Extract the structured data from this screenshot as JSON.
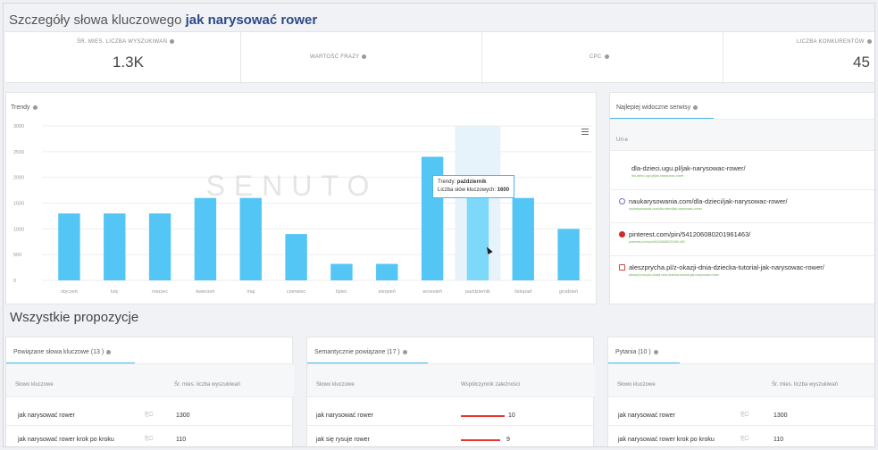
{
  "header": {
    "title_prefix": "Szczegóły słowa kluczowego",
    "keyword": "jak narysować rower"
  },
  "stats": [
    {
      "label": "ŚR. MIES. LICZBA WYSZUKIWAŃ",
      "value": "1.3K"
    },
    {
      "label": "WARTOŚĆ FRAZY",
      "value": ""
    },
    {
      "label": "CPC",
      "value": ""
    },
    {
      "label": "LICZBA KONKURENTÓW",
      "value": "45"
    }
  ],
  "trends": {
    "title": "Trendy",
    "watermark": "SENUTO",
    "tooltip": {
      "series": "Trendy:",
      "month": "październik",
      "label": "Liczba słów kluczowych:",
      "value": "1600"
    }
  },
  "chart_data": {
    "type": "bar",
    "categories": [
      "styczeń",
      "luty",
      "marzec",
      "kwiecień",
      "maj",
      "czerwiec",
      "lipiec",
      "sierpień",
      "wrzesień",
      "październik",
      "listopad",
      "grudzień"
    ],
    "values": [
      1300,
      1300,
      1300,
      1600,
      1600,
      900,
      320,
      320,
      2400,
      1600,
      1600,
      1000
    ],
    "yticks": [
      "3000",
      "2500",
      "2000",
      "1500",
      "1000",
      "500",
      "0"
    ],
    "ylim": [
      0,
      3000
    ],
    "highlight_index": 9,
    "bar_color": "#54c6f5",
    "highlight_color": "#7dd8fa"
  },
  "services": {
    "title": "Najlepiej widoczne serwisy",
    "col": "Url-e",
    "rows": [
      {
        "icon": "",
        "url": "dla-dzieci.ugu.pl/jak-narysowac-rower/",
        "sub": "dla-dzieci.ugu.pl/jak-narysowac-rower"
      },
      {
        "icon": "globe-icon",
        "url": "naukarysowania.com/dla-dzieci/jak-narysowac-rower/",
        "sub": "naukarysowania.com/dla-dzieci/jak-narysowac-rower"
      },
      {
        "icon": "pinterest-icon",
        "url": "pinterest.com/pin/541206080201961463/",
        "sub": "pinterest.com/pin/541206080201961463"
      },
      {
        "icon": "blog-icon",
        "url": "aleszprycha.pl/z-okazji-dnia-dziecka-tutorial-jak-narysowac-rower/",
        "sub": "aleszprycha.pl/z-okazji-dnia-dziecka-tutorial-jak-narysowac-rower"
      }
    ]
  },
  "section_title": "Wszystkie propozycje",
  "related": {
    "title": "Powiązane słowa kluczowe",
    "count": "(13 )",
    "col1": "Słowo kluczowe",
    "col2": "Śr. mies. liczba wyszukiwań",
    "rows": [
      {
        "kw": "jak narysować rower",
        "val": "1300"
      },
      {
        "kw": "jak narysować rower krok po kroku",
        "val": "110"
      }
    ]
  },
  "semantic": {
    "title": "Semantycznie powiązane",
    "count": "(17 )",
    "col1": "Słowo kluczowe",
    "col2": "Współczynnik zależności",
    "rows": [
      {
        "kw": "jak narysować rower",
        "val": "10"
      },
      {
        "kw": "jak się rysuje rower",
        "val": "9"
      }
    ]
  },
  "questions": {
    "title": "Pytania",
    "count": "(10 )",
    "col1": "Słowo kluczowe",
    "col2": "Śr. mies. liczba wyszukiwań",
    "rows": [
      {
        "kw": "jak narysować rower",
        "val": "1300"
      },
      {
        "kw": "jak narysować rower krok po kroku",
        "val": "110"
      }
    ]
  }
}
